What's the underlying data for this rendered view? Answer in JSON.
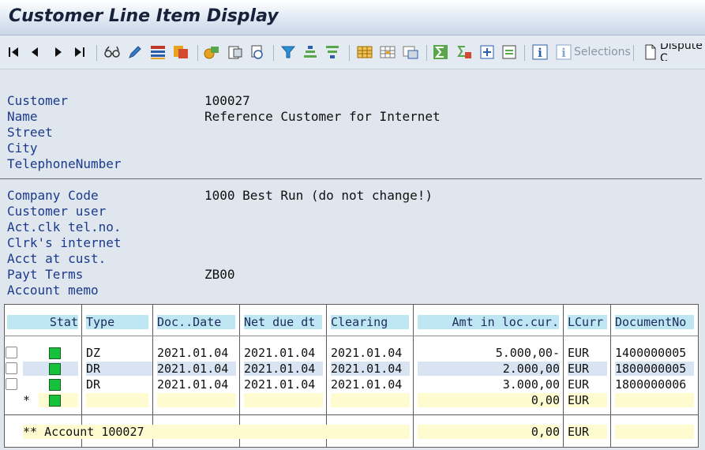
{
  "window": {
    "title": "Customer Line Item Display"
  },
  "toolbar": {
    "selections_label": "Selections",
    "dispute_label": "Dispute C",
    "icons": [
      "first-page",
      "prev-page",
      "next-page",
      "last-page",
      "glasses",
      "pencil",
      "layout",
      "display-change",
      "currency",
      "document",
      "mail",
      "filter",
      "sort-asc",
      "sort-desc",
      "grid",
      "grid-sub",
      "grid-total",
      "sum",
      "subtotal",
      "export",
      "import",
      "info",
      "selections-info",
      "dispute-doc"
    ]
  },
  "header_block": {
    "rows": [
      {
        "label": "Customer",
        "value": "100027"
      },
      {
        "label": "Name",
        "value": "Reference Customer for Internet"
      },
      {
        "label": "Street",
        "value": ""
      },
      {
        "label": "City",
        "value": ""
      },
      {
        "label": "TelephoneNumber",
        "value": ""
      }
    ]
  },
  "company_block": {
    "rows": [
      {
        "label": "Company Code",
        "value": "1000 Best Run (do not change!)"
      },
      {
        "label": "Customer user",
        "value": ""
      },
      {
        "label": "Act.clk tel.no.",
        "value": ""
      },
      {
        "label": "Clrk's internet",
        "value": ""
      },
      {
        "label": "Acct at cust.",
        "value": ""
      },
      {
        "label": "Payt Terms",
        "value": "ZB00"
      },
      {
        "label": "Account memo",
        "value": ""
      }
    ]
  },
  "table": {
    "columns": [
      "Stat",
      "Type",
      "Doc..Date",
      "Net due dt",
      "Clearing",
      "Amt in loc.cur.",
      "LCurr",
      "DocumentNo"
    ],
    "rows": [
      {
        "type": "DZ",
        "doc_date": "2021.01.04",
        "net_due": "2021.01.04",
        "clearing": "2021.01.04",
        "amount": "5.000,00-",
        "curr": "EUR",
        "doc_no": "1400000005"
      },
      {
        "type": "DR",
        "doc_date": "2021.01.04",
        "net_due": "2021.01.04",
        "clearing": "2021.01.04",
        "amount": "2.000,00",
        "curr": "EUR",
        "doc_no": "1800000005"
      },
      {
        "type": "DR",
        "doc_date": "2021.01.04",
        "net_due": "2021.01.04",
        "clearing": "2021.01.04",
        "amount": "3.000,00",
        "curr": "EUR",
        "doc_no": "1800000006"
      }
    ],
    "subtotal": {
      "marker": "*",
      "amount": "0,00",
      "curr": "EUR"
    },
    "total": {
      "label": "** Account 100027",
      "amount": "0,00",
      "curr": "EUR"
    }
  },
  "colors": {
    "label_blue": "#1c3a8c",
    "header_bg": "#bfe6f3",
    "subtotal_bg": "#fffbd0",
    "status_green": "#16c23a"
  }
}
